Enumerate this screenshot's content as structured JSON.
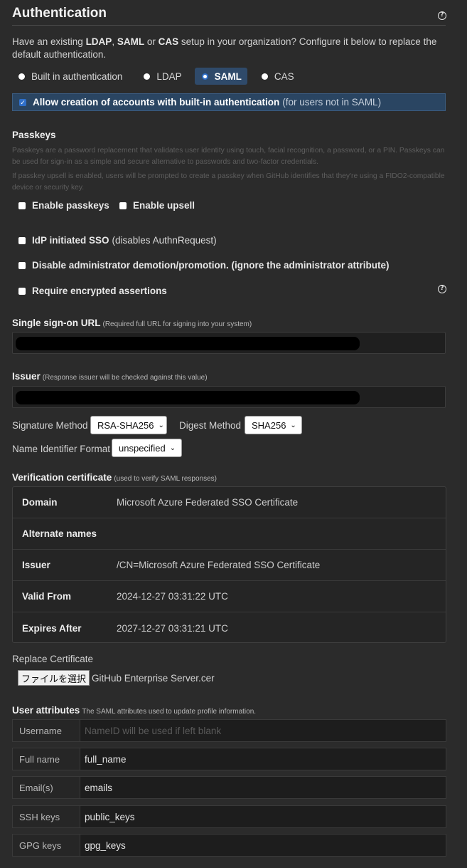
{
  "header": {
    "title": "Authentication",
    "help_icon": "question-circle-icon"
  },
  "intro": {
    "pre": "Have an existing ",
    "ldap": "LDAP",
    "sep1": ", ",
    "saml": "SAML",
    "sep2": " or ",
    "cas": "CAS",
    "post": " setup in your organization? Configure it below to replace the default authentication."
  },
  "auth_options": [
    {
      "label": "Built in authentication",
      "selected": false
    },
    {
      "label": "LDAP",
      "selected": false
    },
    {
      "label": "SAML",
      "selected": true
    },
    {
      "label": "CAS",
      "selected": false
    }
  ],
  "allow_creation": {
    "label": "Allow creation of accounts with built-in authentication",
    "note": "(for users not in SAML)",
    "checked": true
  },
  "passkeys": {
    "heading": "Passkeys",
    "desc1": "Passkeys are a password replacement that validates user identity using touch, facial recognition, a password, or a PIN. Passkeys can be used for sign-in as a simple and secure alternative to passwords and two-factor credentials.",
    "desc2": "If passkey upsell is enabled, users will be prompted to create a passkey when GitHub identifies that they're using a FIDO2-compatible device or security key.",
    "enable_label": "Enable passkeys",
    "upsell_label": "Enable upsell"
  },
  "options": {
    "idp_sso": "IdP initiated SSO",
    "idp_sso_note": "(disables AuthnRequest)",
    "disable_admin": "Disable administrator demotion/promotion. (ignore the administrator attribute)",
    "require_encrypted": "Require encrypted assertions"
  },
  "sso_url": {
    "label": "Single sign-on URL",
    "hint": "(Required full URL for signing into your system)"
  },
  "issuer": {
    "label": "Issuer",
    "hint": "(Response issuer will be checked against this value)"
  },
  "methods": {
    "signature_label": "Signature Method",
    "signature_value": "RSA-SHA256",
    "digest_label": "Digest Method",
    "digest_value": "SHA256",
    "name_id_label": "Name Identifier Format",
    "name_id_value": "unspecified"
  },
  "certificate": {
    "label": "Verification certificate",
    "hint": "(used to verify SAML responses)",
    "rows": [
      {
        "key": "Domain",
        "value": "Microsoft Azure Federated SSO Certificate"
      },
      {
        "key": "Alternate names",
        "value": ""
      },
      {
        "key": "Issuer",
        "value": "/CN=Microsoft Azure Federated SSO Certificate"
      },
      {
        "key": "Valid From",
        "value": "2024-12-27 03:31:22 UTC"
      },
      {
        "key": "Expires After",
        "value": "2027-12-27 03:31:21 UTC"
      }
    ]
  },
  "replace_cert": {
    "label": "Replace Certificate",
    "button": "ファイルを選択",
    "filename": "GitHub Enterprise Server.cer"
  },
  "user_attributes": {
    "label": "User attributes",
    "hint": "The SAML attributes used to update profile information.",
    "rows": [
      {
        "key": "Username",
        "value": "",
        "placeholder": "NameID will be used if left blank"
      },
      {
        "key": "Full name",
        "value": "full_name"
      },
      {
        "key": "Email(s)",
        "value": "emails"
      },
      {
        "key": "SSH keys",
        "value": "public_keys"
      },
      {
        "key": "GPG keys",
        "value": "gpg_keys"
      }
    ]
  }
}
